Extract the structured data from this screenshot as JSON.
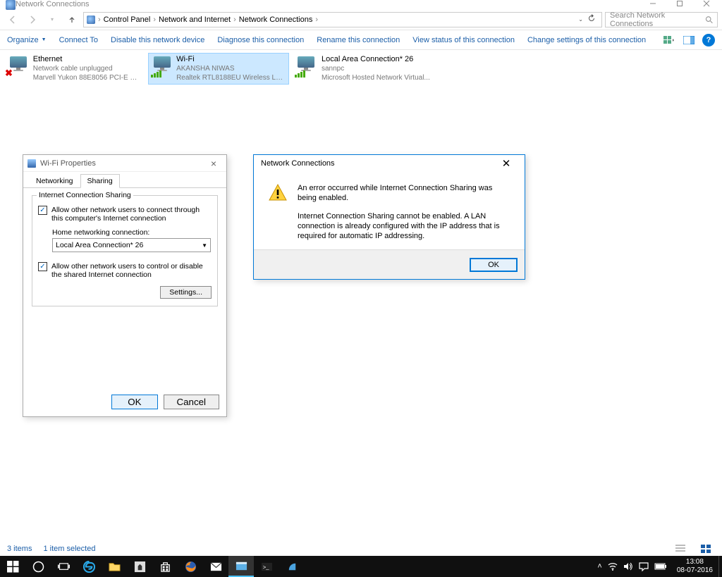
{
  "window": {
    "title": "Network Connections"
  },
  "breadcrumbs": {
    "cp": "Control Panel",
    "nai": "Network and Internet",
    "nc": "Network Connections"
  },
  "search": {
    "placeholder": "Search Network Connections"
  },
  "toolbar": {
    "organize": "Organize",
    "connect": "Connect To",
    "disable": "Disable this network device",
    "diagnose": "Diagnose this connection",
    "rename": "Rename this connection",
    "viewstatus": "View status of this connection",
    "changesettings": "Change settings of this connection"
  },
  "connections": [
    {
      "name": "Ethernet",
      "status": "Network cable unplugged",
      "adapter": "Marvell Yukon 88E8056 PCI-E Gig..."
    },
    {
      "name": "Wi-Fi",
      "status": "AKANSHA NIWAS",
      "adapter": "Realtek RTL8188EU Wireless LAN ..."
    },
    {
      "name": "Local Area Connection* 26",
      "status": "sannpc",
      "adapter": "Microsoft Hosted Network Virtual..."
    }
  ],
  "wifi_props": {
    "title": "Wi-Fi Properties",
    "tab_networking": "Networking",
    "tab_sharing": "Sharing",
    "group_title": "Internet Connection Sharing",
    "chk1": "Allow other network users to connect through this computer's Internet connection",
    "home_label": "Home networking connection:",
    "combo_value": "Local Area Connection* 26",
    "chk2": "Allow other network users to control or disable the shared Internet connection",
    "settings": "Settings...",
    "ok": "OK",
    "cancel": "Cancel"
  },
  "error_dlg": {
    "title": "Network Connections",
    "msg1": "An error occurred while Internet Connection Sharing was being enabled.",
    "msg2": "Internet Connection Sharing cannot be enabled.  A LAN connection is already configured with the IP address that is required for automatic IP addressing.",
    "ok": "OK"
  },
  "statusbar": {
    "count": "3 items",
    "selected": "1 item selected"
  },
  "clock": {
    "time": "13:08",
    "date": "08-07-2016"
  }
}
